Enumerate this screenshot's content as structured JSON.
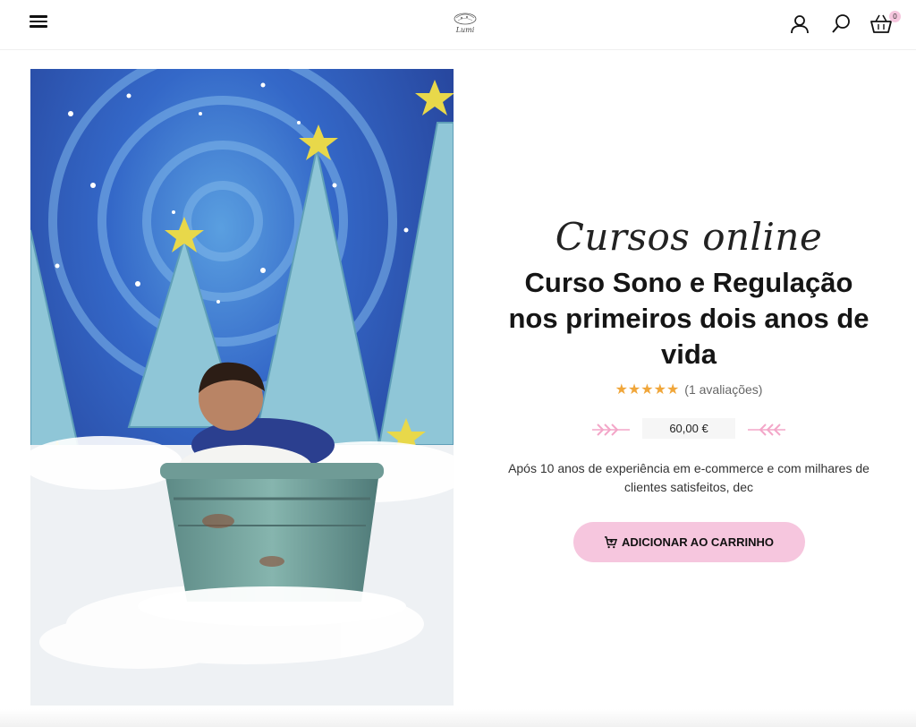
{
  "header": {
    "menu_icon": "hamburger-menu-icon",
    "logo_text": "Lumi",
    "account_icon": "user-icon",
    "search_icon": "search-icon",
    "cart_icon": "basket-icon",
    "cart_count": "0"
  },
  "product": {
    "image_alt": "newborn-in-bucket-photo",
    "category": "Cursos online",
    "title": "Curso Sono e Regulação nos primeiros dois anos de vida",
    "rating_value": 5,
    "rating_text": "(1 avaliações)",
    "price": "60,00 €",
    "description": "Após 10 anos de experiência em e-commerce e com milhares de clientes satisfeitos, dec",
    "add_to_cart_label": "ADICIONAR AO CARRINHO"
  },
  "colors": {
    "accent_pink": "#f6c6de",
    "star_orange": "#f0a63a",
    "price_bg": "#f6f6f6"
  }
}
